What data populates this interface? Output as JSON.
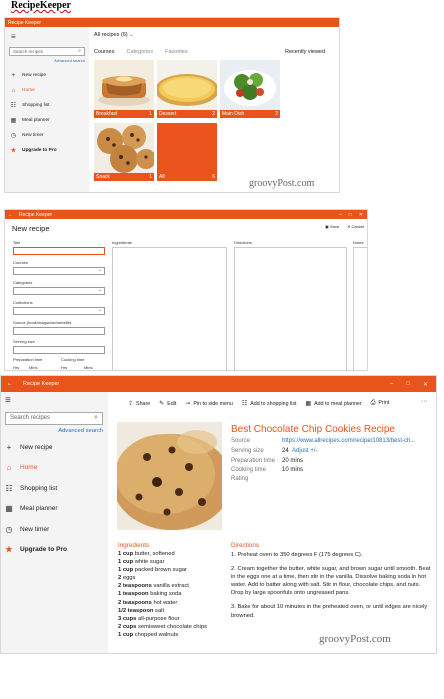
{
  "doc_title": "RecipeKeeper",
  "colors": {
    "accent": "#e8541c",
    "link": "#2a6ebb",
    "sidebar": "#f4f4f4"
  },
  "w1": {
    "app_title": "Recipe Keeper",
    "search_placeholder": "Search recipes",
    "advanced": "Advanced search",
    "nav": [
      "New recipe",
      "Home",
      "Shopping list",
      "Meal planner",
      "New timer",
      "Upgrade to Pro"
    ],
    "all_recipes": "All recipes (6)",
    "tabs": [
      "Courses",
      "Categories",
      "Favorites"
    ],
    "recently": "Recently viewed",
    "tiles": [
      {
        "label": "Breakfast",
        "count": "1"
      },
      {
        "label": "Dessert",
        "count": "2"
      },
      {
        "label": "Main Dish",
        "count": "2"
      },
      {
        "label": "Snack",
        "count": "1"
      },
      {
        "label": "All",
        "count": "6"
      }
    ],
    "watermark": "groovyPost.com"
  },
  "w2": {
    "app_title": "Recipe Keeper",
    "heading": "New recipe",
    "save": "Save",
    "cancel": "Cancel",
    "fields": {
      "title": "Title",
      "courses": "Courses",
      "categories": "Categories",
      "collections": "Collections",
      "source": "Source (book/magazine/website)",
      "serving": "Serving size",
      "prep": "Preparation time",
      "cook": "Cooking time",
      "hrs": "Hrs",
      "mins": "Mins"
    },
    "columns": [
      "Ingredients",
      "Directions",
      "Notes"
    ]
  },
  "w3": {
    "app_title": "Recipe Keeper",
    "search_placeholder": "Search recipes",
    "advanced": "Advanced search",
    "nav": [
      "New recipe",
      "Home",
      "Shopping list",
      "Meal planner",
      "New timer",
      "Upgrade to Pro"
    ],
    "toolbar": [
      "Share",
      "Edit",
      "Pin to side menu",
      "Add to shopping list",
      "Add to meal planner",
      "Print"
    ],
    "recipe_title": "Best Chocolate Chip Cookies Recipe",
    "meta": {
      "source_label": "Source",
      "source_value": "https://www.allrecipes.com/recipe/10813/best-ch...",
      "serving_label": "Serving size",
      "serving_value": "24",
      "adjust": "Adjust +/-",
      "prep_label": "Preparation time",
      "prep_value": "20 mins",
      "cook_label": "Cooking time",
      "cook_value": "10 mins",
      "rating_label": "Rating"
    },
    "ingredients_heading": "Ingredients",
    "ingredients": [
      {
        "qty": "1 cup",
        "item": " butter, softened"
      },
      {
        "qty": "1 cup",
        "item": " white sugar"
      },
      {
        "qty": "1 cup",
        "item": " packed brown sugar"
      },
      {
        "qty": "2",
        "item": " eggs"
      },
      {
        "qty": "2 teaspoons",
        "item": " vanilla extract"
      },
      {
        "qty": "1 teaspoon",
        "item": " baking soda"
      },
      {
        "qty": "2 teaspoons",
        "item": " hot water"
      },
      {
        "qty": "1/2 teaspoon",
        "item": " salt"
      },
      {
        "qty": "3 cups",
        "item": " all-purpose flour"
      },
      {
        "qty": "2 cups",
        "item": " semisweet chocolate chips"
      },
      {
        "qty": "1 cup",
        "item": " chopped walnuts"
      }
    ],
    "directions_heading": "Directions",
    "directions": [
      "1. Preheat oven to 350 degrees F (175 degrees C).",
      "2. Cream together the butter, white sugar, and brown sugar until smooth. Beat in the eggs one at a time, then stir in the vanilla. Dissolve baking soda in hot water. Add to batter along with salt. Stir in flour, chocolate chips, and nuts. Drop by large spoonfuls onto ungreased pans.",
      "3. Bake for about 10 minutes in the preheated oven, or until edges are nicely browned."
    ],
    "watermark": "groovyPost.com"
  }
}
